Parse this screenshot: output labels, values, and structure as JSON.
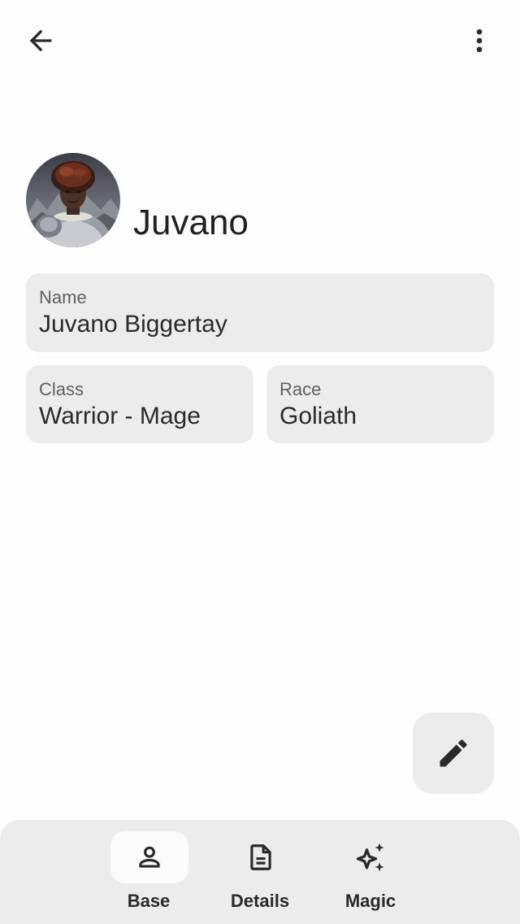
{
  "character": {
    "title": "Juvano"
  },
  "fields": {
    "name": {
      "label": "Name",
      "value": "Juvano Biggertay"
    },
    "class": {
      "label": "Class",
      "value": "Warrior - Mage"
    },
    "race": {
      "label": "Race",
      "value": "Goliath"
    }
  },
  "nav": {
    "items": [
      {
        "label": "Base",
        "icon": "person-icon",
        "active": true
      },
      {
        "label": "Details",
        "icon": "document-icon",
        "active": false
      },
      {
        "label": "Magic",
        "icon": "sparkle-icon",
        "active": false
      }
    ]
  },
  "icons": {
    "back": "arrow-left-icon",
    "more": "more-vertical-icon",
    "edit": "pencil-icon"
  },
  "colors": {
    "card_background": "#ececec",
    "nav_background": "#ececec",
    "active_pill": "#fbfbfb",
    "text_primary": "#2a2a2a",
    "text_secondary": "#5f5f5f"
  }
}
